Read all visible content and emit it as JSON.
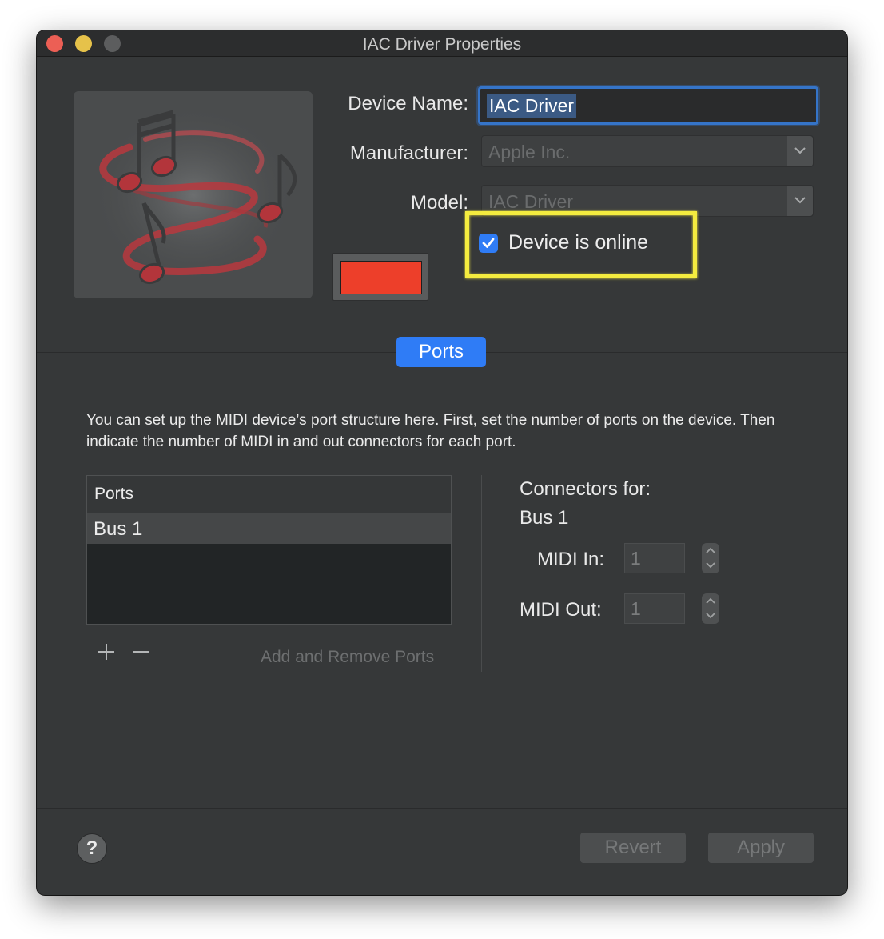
{
  "window": {
    "title": "IAC Driver Properties"
  },
  "device": {
    "name_label": "Device Name:",
    "name_value": "IAC Driver",
    "manufacturer_label": "Manufacturer:",
    "manufacturer_value": "Apple Inc.",
    "model_label": "Model:",
    "model_value": "IAC Driver",
    "online_label": "Device is online",
    "online_checked": true,
    "color": "#ed3f2a"
  },
  "tabs": [
    {
      "label": "Ports",
      "selected": true
    }
  ],
  "ports": {
    "description": "You can set up the MIDI device’s port structure here. First, set the number of ports on the device. Then indicate the number of MIDI in and out connectors for each port.",
    "table_header": "Ports",
    "rows": [
      "Bus 1"
    ],
    "add_remove_label": "Add and Remove Ports"
  },
  "connectors": {
    "title": "Connectors for:",
    "port_name": "Bus 1",
    "midi_in_label": "MIDI In:",
    "midi_in_value": "1",
    "midi_out_label": "MIDI Out:",
    "midi_out_value": "1"
  },
  "footer": {
    "help_label": "?",
    "revert_label": "Revert",
    "apply_label": "Apply"
  },
  "colors": {
    "accent": "#2f7cf6",
    "highlight": "#f4ec3f",
    "window_bg": "#363839"
  }
}
